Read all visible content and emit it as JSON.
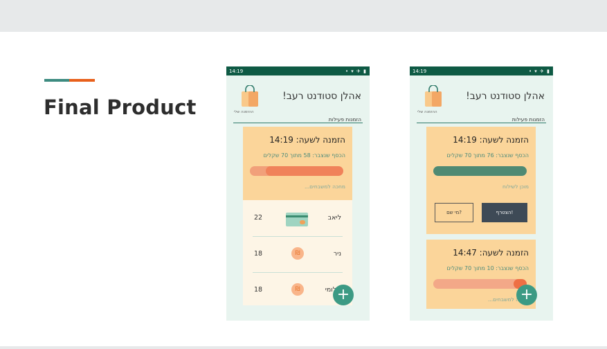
{
  "slide": {
    "title": "Final Product"
  },
  "colors": {
    "accent_teal": "#3d8b80",
    "accent_orange": "#e8601c",
    "status_bar": "#0e5a44",
    "card": "#fbd59a",
    "fab": "#3c9a84"
  },
  "phone_common": {
    "status_time": "14:19",
    "status_icons": "• ▾ ✈ ▮",
    "bag_label": "ההזמנה שלי",
    "greeting": "אהלן סטודנט רעב!",
    "tab_label": "הזמנות פעילות",
    "fab_symbol": "+"
  },
  "phone1": {
    "order": {
      "time": "הזמנה לשעה: 14:19",
      "collected": "הכסף שנצבר: 58 מתוך 70 שקלים",
      "progress": 0.83,
      "status": "מחכה למשבחים..."
    },
    "participants": [
      {
        "name": "ליאב",
        "amount": "22",
        "icon": "credit-card-icon"
      },
      {
        "name": "ניר",
        "amount": "18",
        "icon": "coin-icon",
        "glyph": "₪"
      },
      {
        "name": "שלומי",
        "amount": "18",
        "icon": "coin-icon",
        "glyph": "₪"
      }
    ]
  },
  "phone2": {
    "order1": {
      "time": "הזמנה לשעה: 14:19",
      "collected": "הכסף שנצבר: 76 מתוך 70 שקלים",
      "progress": 1.0,
      "status": "מוכן לשילוח",
      "join_label": "הצטרף!",
      "who_label": "מי שם?"
    },
    "order2": {
      "time": "הזמנה לשעה: 14:47",
      "collected": "הכסף שנצבר: 10 מתוך 70 שקלים",
      "progress": 0.14,
      "status": "מחכה למשבחים..."
    }
  }
}
